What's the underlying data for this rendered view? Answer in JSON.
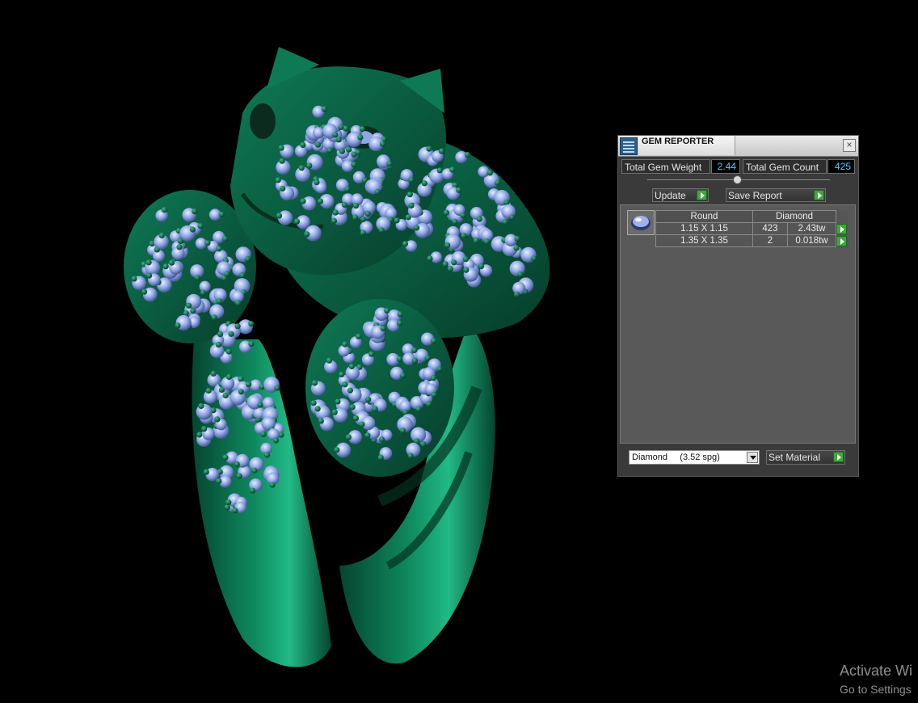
{
  "panel": {
    "title": "GEM REPORTER",
    "close_glyph": "×",
    "total_weight_label": "Total Gem Weight",
    "total_weight_value": "2.44",
    "total_count_label": "Total Gem Count",
    "total_count_value": "425",
    "update_label": "Update",
    "save_report_label": "Save Report",
    "table": {
      "headers": [
        "Round",
        "Diamond"
      ],
      "rows": [
        {
          "size": "1.15 X 1.15",
          "count": "423",
          "weight": "2.43tw"
        },
        {
          "size": "1.35 X 1.35",
          "count": "2",
          "weight": "0.018tw"
        }
      ]
    },
    "material_value": "Diamond     (3.52 spg)",
    "set_material_label": "Set Material"
  },
  "watermark": {
    "line1": "Activate Wi",
    "line2": "Go to Settings"
  },
  "colors": {
    "metal": "#0b6b4a",
    "gem": "#8fa6e6",
    "accent_value": "#59c8e8",
    "go_button": "#3fa83a"
  },
  "icons": [
    "gem-reporter-icon",
    "close-icon",
    "arrow-right-icon",
    "gem-preview-icon",
    "dropdown-arrow-icon"
  ]
}
